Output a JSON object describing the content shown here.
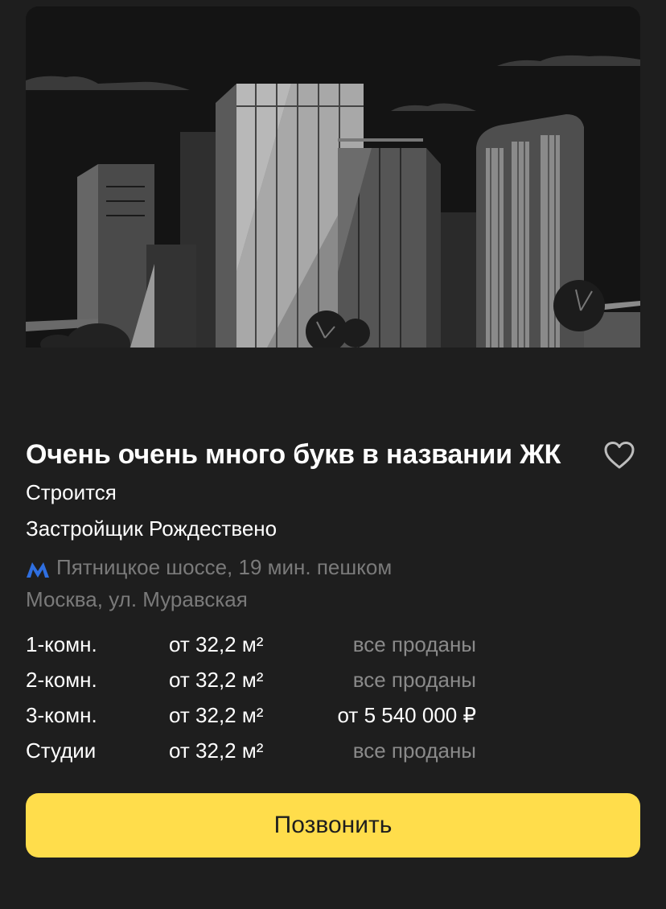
{
  "complex": {
    "title": "Очень очень много букв в названии ЖК",
    "status": "Строится",
    "developer": "Застройщик Рождествено",
    "metro": "Пятницкое шоссе, 19 мин. пешком",
    "address": "Москва, ул. Муравская"
  },
  "offers": [
    {
      "rooms": "1-комн.",
      "area": "от 32,2 м²",
      "price": "все проданы"
    },
    {
      "rooms": "2-комн.",
      "area": "от 32,2 м²",
      "price": "все проданы"
    },
    {
      "rooms": "3-комн.",
      "area": "от 32,2 м²",
      "price": "от 5 540 000 ₽"
    },
    {
      "rooms": "Студии",
      "area": "от 32,2 м²",
      "price": "все проданы"
    }
  ],
  "actions": {
    "call_label": "Позвонить"
  },
  "icons": {
    "favorite": "heart-outline-icon",
    "metro": "metro-m-icon"
  },
  "colors": {
    "background": "#1e1e1e",
    "call_button": "#ffdd4b",
    "metro_logo": "#2f6fe0",
    "muted_text": "#7a7a7a"
  }
}
